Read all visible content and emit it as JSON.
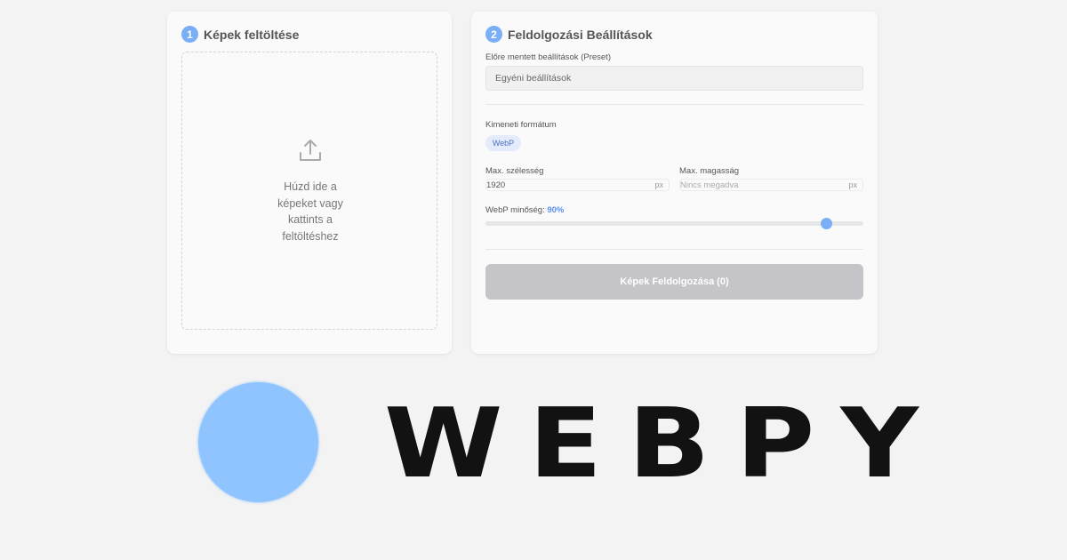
{
  "upload_card": {
    "step_number": "1",
    "title": "Képek feltöltése",
    "dropzone_text": "Húzd ide a képeket vagy kattints a feltöltéshez",
    "icon": "upload-icon"
  },
  "settings_card": {
    "step_number": "2",
    "title": "Feldolgozási Beállítások",
    "preset": {
      "label": "Előre mentett beállítások (Preset)",
      "value": "Egyéni beállítások"
    },
    "output_format": {
      "label": "Kimeneti formátum",
      "selected": "WebP"
    },
    "max_width": {
      "label": "Max. szélesség",
      "value": "1920",
      "unit": "px"
    },
    "max_height": {
      "label": "Max. magasság",
      "placeholder": "Nincs megadva",
      "unit": "px"
    },
    "quality": {
      "label": "WebP minőség:",
      "value_text": "90%",
      "value": 0.9
    },
    "process_button": "Képek Feldolgozása (0)"
  },
  "logo": {
    "text": "WEBPY",
    "circle_color": "#90c4fe"
  },
  "colors": {
    "accent": "#7aaef7",
    "button_disabled": "#c4c4c9",
    "background": "#f3f3f3"
  }
}
